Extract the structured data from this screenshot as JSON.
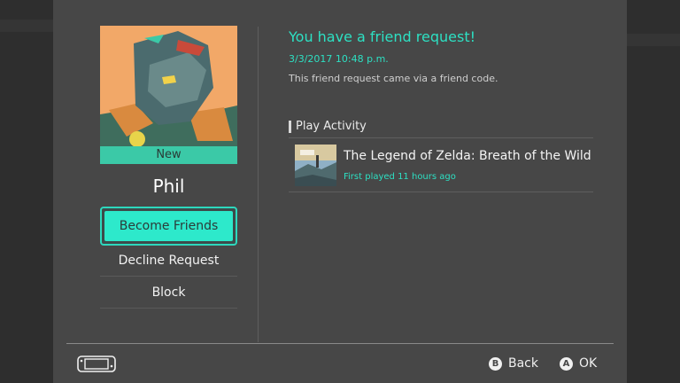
{
  "profile": {
    "new_badge": "New",
    "name": "Phil"
  },
  "actions": {
    "become_friends": "Become Friends",
    "decline": "Decline Request",
    "block": "Block"
  },
  "request": {
    "title": "You have a friend request!",
    "datetime": "3/3/2017 10:48 p.m.",
    "note": "This friend request came via a friend code."
  },
  "play_activity": {
    "heading": "Play Activity",
    "games": [
      {
        "title": "The Legend of Zelda: Breath of the Wild",
        "subtitle": "First played 11 hours ago"
      }
    ]
  },
  "footer": {
    "back_glyph": "B",
    "back_label": "Back",
    "ok_glyph": "A",
    "ok_label": "OK"
  },
  "colors": {
    "accent": "#2de0c3",
    "panel": "#474747",
    "background": "#2b2b2b"
  }
}
